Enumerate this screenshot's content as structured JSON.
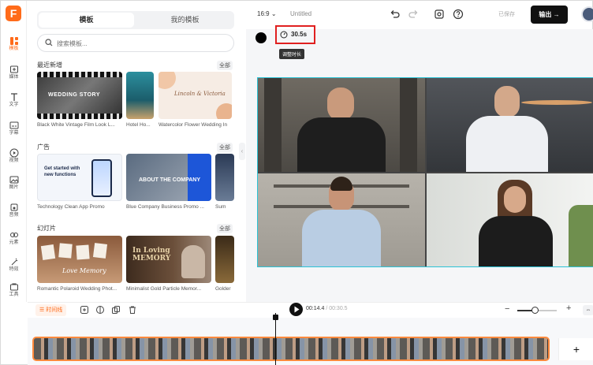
{
  "sidebar": {
    "logo": "F",
    "items": [
      {
        "label": "模板",
        "icon": "template-icon",
        "active": true
      },
      {
        "label": "媒体",
        "icon": "media-icon"
      },
      {
        "label": "文字",
        "icon": "text-icon"
      },
      {
        "label": "字幕",
        "icon": "subtitle-icon"
      },
      {
        "label": "视频",
        "icon": "video-icon"
      },
      {
        "label": "图片",
        "icon": "image-icon"
      },
      {
        "label": "音频",
        "icon": "audio-icon"
      },
      {
        "label": "元素",
        "icon": "elements-icon"
      },
      {
        "label": "特效",
        "icon": "effects-icon"
      },
      {
        "label": "工具",
        "icon": "tools-icon"
      }
    ]
  },
  "panel": {
    "tabs": [
      "模板",
      "我的模板"
    ],
    "search_placeholder": "搜索模板...",
    "sections": [
      {
        "title": "最近新增",
        "all": "全部",
        "cards": [
          "Black White Vintage Film Look L...",
          "Hotel Ho...",
          "Watercolor Flower Wedding In"
        ]
      },
      {
        "title": "广告",
        "all": "全部",
        "cards": [
          "Technology Clean App Promo",
          "Blue Company Business Promo ...",
          "Sum"
        ]
      },
      {
        "title": "幻灯片",
        "all": "全部",
        "cards": [
          "Romantic Polaroid Wedding Phot...",
          "Minimalist Gold Particle Memor...",
          "Golder"
        ]
      }
    ],
    "thumb_texts": {
      "wedding_story": "WEDDING STORY",
      "invite": "Lincoln & Victoria",
      "app_promo": "Get started with new functions",
      "company": "ABOUT THE COMPANY",
      "love_memory": "Love Memory",
      "in_loving": "In Loving MEMORY"
    }
  },
  "topbar": {
    "ratio": "16:9",
    "project_title": "Untitled",
    "saved_status": "已保存",
    "export_label": "输出"
  },
  "canvas": {
    "duration": "30.5s",
    "tooltip": "调整时长"
  },
  "timeline": {
    "label": "时间线",
    "current_time": "00:14.4",
    "total_time": "/ 00:30.5",
    "zoom_level": 0.45,
    "add_label": "+"
  },
  "colors": {
    "accent": "#ff6b1a",
    "selection": "#2bc3d6",
    "highlight_box": "#e02020",
    "clip_border": "#ff8a3d"
  }
}
